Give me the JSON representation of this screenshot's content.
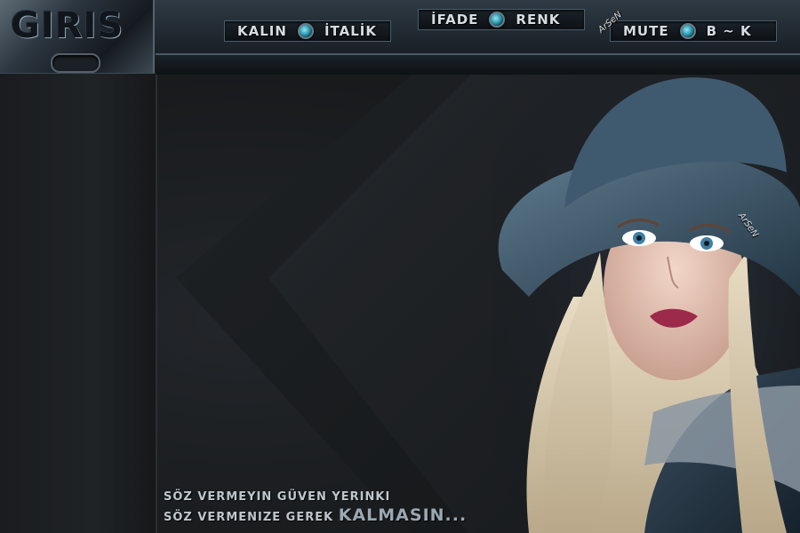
{
  "logo": {
    "text": "GIRIS"
  },
  "controls": {
    "group1": {
      "left": "KALIN",
      "right": "İTALİK"
    },
    "group2": {
      "left": "İFADE",
      "right": "RENK"
    },
    "group3": {
      "left": "MUTE",
      "right": "B ~ K"
    }
  },
  "watermark": {
    "text": "ArSeN"
  },
  "quote": {
    "line1": "SÖZ VERMEYIN GÜVEN YERINKI",
    "line2_prefix": "SÖZ VERMENIZE GEREK ",
    "line2_accent": "KALMASIN..."
  },
  "colors": {
    "accent": "#2b9bb2",
    "frame": "#4b5c69",
    "text": "#d5dde2"
  }
}
